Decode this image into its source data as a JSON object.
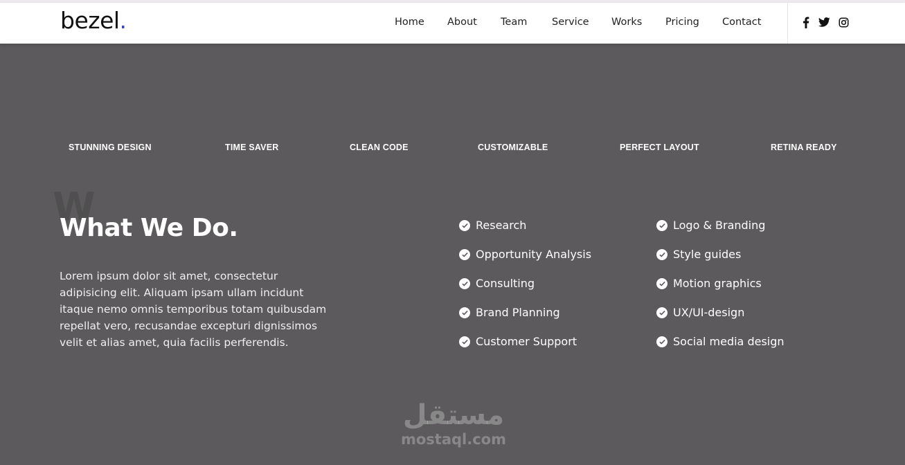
{
  "brand": {
    "name": "bezel",
    "dot": ".",
    "accent": "#3b49b8"
  },
  "nav": [
    "Home",
    "About",
    "Team",
    "Service",
    "Works",
    "Pricing",
    "Contact"
  ],
  "social": [
    "facebook-icon",
    "twitter-icon",
    "instagram-icon"
  ],
  "features": [
    "STUNNING DESIGN",
    "TIME SAVER",
    "CLEAN CODE",
    "CUSTOMIZABLE",
    "PERFECT LAYOUT",
    "RETINA READY"
  ],
  "section": {
    "ghost": "W",
    "title": "What We Do.",
    "description": "Lorem ipsum dolor sit amet, consectetur adipisicing elit. Aliquam ipsam ullam incidunt itaque nemo omnis temporibus totam quibusdam repellat vero, recusandae excepturi dignissimos velit et alias amet, quia facilis perferendis."
  },
  "services_left": [
    "Research",
    "Opportunity Analysis",
    "Consulting",
    "Brand Planning",
    "Customer Support"
  ],
  "services_right": [
    "Logo & Branding",
    "Style guides",
    "Motion graphics",
    "UX/UI-design",
    "Social media design"
  ],
  "watermark": {
    "arabic": "مستقل",
    "latin": "mostaql.com"
  },
  "colors": {
    "background": "#5c5a5c",
    "navbar": "#ffffff",
    "text_light": "#ffffff"
  }
}
